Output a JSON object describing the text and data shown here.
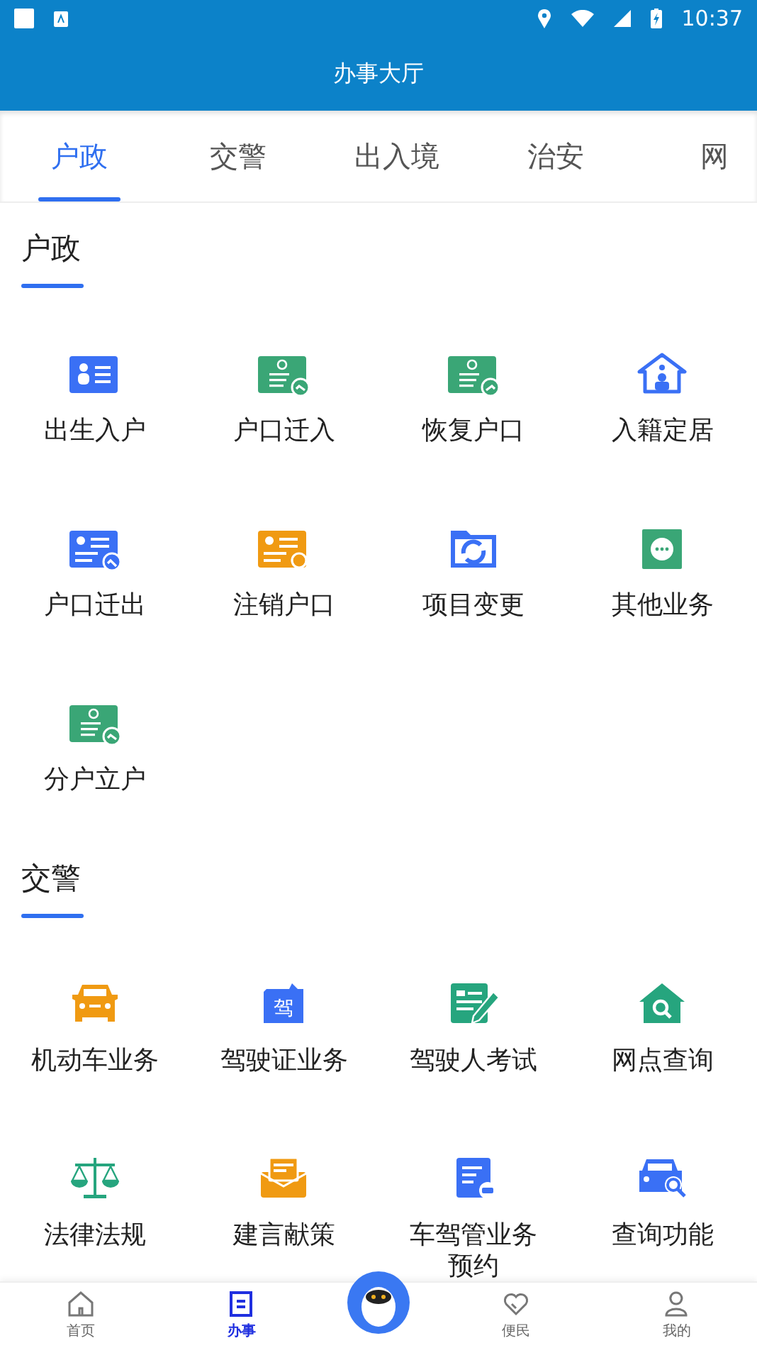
{
  "status_bar": {
    "time": "10:37"
  },
  "header": {
    "title": "办事大厅"
  },
  "tabs": [
    {
      "label": "户政",
      "selected": true
    },
    {
      "label": "交警",
      "selected": false
    },
    {
      "label": "出入境",
      "selected": false
    },
    {
      "label": "治安",
      "selected": false
    },
    {
      "label": "网",
      "selected": false
    }
  ],
  "sections": [
    {
      "title": "户政",
      "items": [
        {
          "label": "出生入户",
          "kind": "baby-card"
        },
        {
          "label": "户口迁入",
          "kind": "card-in"
        },
        {
          "label": "恢复户口",
          "kind": "card-out"
        },
        {
          "label": "入籍定居",
          "kind": "house-person"
        },
        {
          "label": "户口迁出",
          "kind": "blue-card-back"
        },
        {
          "label": "注销户口",
          "kind": "orange-card-refresh"
        },
        {
          "label": "项目变更",
          "kind": "folder-refresh"
        },
        {
          "label": "其他业务",
          "kind": "more"
        },
        {
          "label": "分户立户",
          "kind": "card-in"
        }
      ]
    },
    {
      "title": "交警",
      "items": [
        {
          "label": "机动车业务",
          "kind": "car"
        },
        {
          "label": "驾驶证业务",
          "kind": "license",
          "badge": "驾"
        },
        {
          "label": "驾驶人考试",
          "kind": "exam"
        },
        {
          "label": "网点查询",
          "kind": "house-search"
        },
        {
          "label": "法律法规",
          "kind": "scale"
        },
        {
          "label": "建言献策",
          "kind": "mail"
        },
        {
          "label": "车驾管业务预约",
          "kind": "doc-car"
        },
        {
          "label": "查询功能",
          "kind": "car-search"
        }
      ]
    }
  ],
  "bottom_nav": [
    {
      "label": "首页",
      "kind": "home",
      "selected": false
    },
    {
      "label": "办事",
      "kind": "doc",
      "selected": true
    },
    {
      "label": "便民",
      "kind": "heart",
      "selected": false
    },
    {
      "label": "我的",
      "kind": "person",
      "selected": false
    }
  ]
}
